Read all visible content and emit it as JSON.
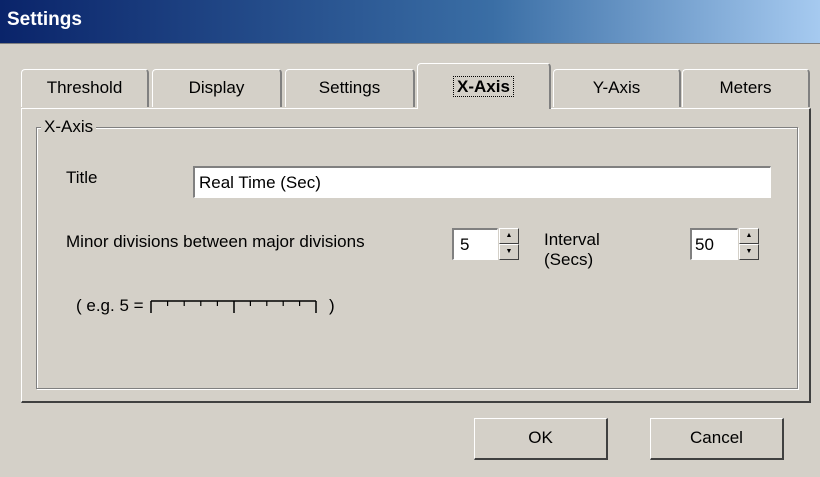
{
  "window": {
    "title": "Settings"
  },
  "tabs": [
    {
      "label": "Threshold"
    },
    {
      "label": "Display"
    },
    {
      "label": "Settings"
    },
    {
      "label": "X-Axis",
      "active": true
    },
    {
      "label": "Y-Axis"
    },
    {
      "label": "Meters"
    }
  ],
  "xaxis": {
    "group_label": "X-Axis",
    "title_label": "Title",
    "title_value": "Real Time (Sec)",
    "minor_label": "Minor divisions between major divisions",
    "minor_value": "5",
    "interval_label_line1": "Interval",
    "interval_label_line2": "(Secs)",
    "interval_value": "50",
    "example_prefix": "( e.g. 5 =",
    "example_suffix": ")"
  },
  "buttons": {
    "ok": "OK",
    "cancel": "Cancel"
  },
  "spin_glyphs": {
    "up": "▲",
    "down": "▼"
  }
}
